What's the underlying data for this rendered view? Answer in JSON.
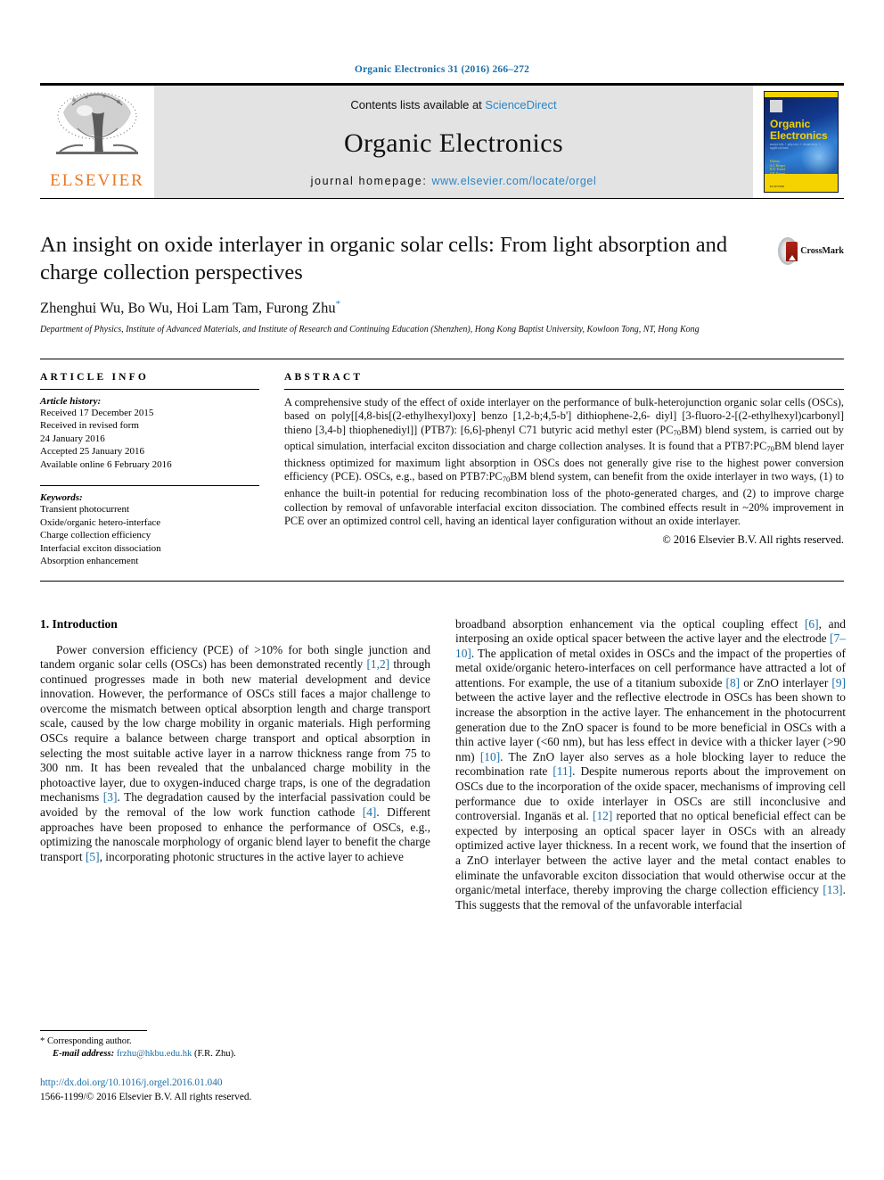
{
  "running_head": "Organic Electronics 31 (2016) 266–272",
  "masthead": {
    "contents_prefix": "Contents lists available at ",
    "contents_link": "ScienceDirect",
    "journal_title": "Organic Electronics",
    "homepage_prefix": "journal homepage: ",
    "homepage_link": "www.elsevier.com/locate/orgel",
    "publisher_name": "ELSEVIER",
    "cover": {
      "line1": "Organic",
      "line2": "Electronics",
      "tagline": "materials • physics • chemistry • applications",
      "editors": "Editors:\nA.J. Heeger\nR.H. Friend\nS.R. Forrest\nY. Yang",
      "publisher": "ELSEVIER"
    }
  },
  "article": {
    "title": "An insight on oxide interlayer in organic solar cells: From light absorption and charge collection perspectives",
    "crossmark_label": "CrossMark",
    "authors": "Zhenghui Wu, Bo Wu, Hoi Lam Tam, Furong Zhu",
    "corresponding_marker": "*",
    "affiliation": "Department of Physics, Institute of Advanced Materials, and Institute of Research and Continuing Education (Shenzhen), Hong Kong Baptist University, Kowloon Tong, NT, Hong Kong"
  },
  "article_info": {
    "heading": "ARTICLE INFO",
    "history_label": "Article history:",
    "history": [
      "Received 17 December 2015",
      "Received in revised form",
      "24 January 2016",
      "Accepted 25 January 2016",
      "Available online 6 February 2016"
    ],
    "keywords_label": "Keywords:",
    "keywords": [
      "Transient photocurrent",
      "Oxide/organic hetero-interface",
      "Charge collection efficiency",
      "Interfacial exciton dissociation",
      "Absorption enhancement"
    ]
  },
  "abstract": {
    "heading": "ABSTRACT",
    "part1": "A comprehensive study of the effect of oxide interlayer on the performance of bulk-heterojunction organic solar cells (OSCs), based on poly[[4,8-bis[(2-ethylhexyl)oxy] benzo [1,2-b;4,5-b'] dithiophene-2,6- diyl] [3-fluoro-2-[(2-ethylhexyl)carbonyl] thieno [3,4-b] thiophenediyl]] (PTB7): [6,6]-phenyl C71 butyric acid methyl ester (PC",
    "sub1": "70",
    "part2": "BM) blend system, is carried out by optical simulation, interfacial exciton dissociation and charge collection analyses. It is found that a PTB7:PC",
    "sub2": "70",
    "part3": "BM blend layer thickness optimized for maximum light absorption in OSCs does not generally give rise to the highest power conversion efficiency (PCE). OSCs, e.g., based on PTB7:PC",
    "sub3": "70",
    "part4": "BM blend system, can benefit from the oxide interlayer in two ways, (1) to enhance the built-in potential for reducing recombination loss of the photo-generated charges, and (2) to improve charge collection by removal of unfavorable interfacial exciton dissociation. The combined effects result in ~20% improvement in PCE over an optimized control cell, having an identical layer configuration without an oxide interlayer.",
    "copyright": "© 2016 Elsevier B.V. All rights reserved."
  },
  "body": {
    "section_heading": "1. Introduction",
    "left_p1_a": "Power conversion efficiency (PCE) of >10% for both single junction and tandem organic solar cells (OSCs) has been demonstrated recently ",
    "left_ref_1_2": "[1,2]",
    "left_p1_b": " through continued progresses made in both new material development and device innovation. However, the performance of OSCs still faces a major challenge to overcome the mismatch between optical absorption length and charge transport scale, caused by the low charge mobility in organic materials. High performing OSCs require a balance between charge transport and optical absorption in selecting the most suitable active layer in a narrow thickness range from 75 to 300 nm. It has been revealed that the unbalanced charge mobility in the photoactive layer, due to oxygen-induced charge traps, is one of the degradation mechanisms ",
    "left_ref_3": "[3]",
    "left_p1_c": ". The degradation caused by the interfacial passivation could be avoided by the removal of the low work function cathode ",
    "left_ref_4": "[4]",
    "left_p1_d": ". Different approaches have been proposed to enhance the performance of OSCs, e.g., optimizing the nanoscale morphology of organic blend layer to benefit the charge transport ",
    "left_ref_5": "[5]",
    "left_p1_e": ", incorporating photonic structures in the active layer to achieve",
    "right_p_a": "broadband absorption enhancement via the optical coupling effect ",
    "right_ref_6": "[6]",
    "right_p_b": ", and interposing an oxide optical spacer between the active layer and the electrode ",
    "right_ref_7_10": "[7–10]",
    "right_p_c": ". The application of metal oxides in OSCs and the impact of the properties of metal oxide/organic hetero-interfaces on cell performance have attracted a lot of attentions. For example, the use of a titanium suboxide ",
    "right_ref_8": "[8]",
    "right_p_d": " or ZnO interlayer ",
    "right_ref_9": "[9]",
    "right_p_e": " between the active layer and the reflective electrode in OSCs has been shown to increase the absorption in the active layer. The enhancement in the photocurrent generation due to the ZnO spacer is found to be more beneficial in OSCs with a thin active layer (<60 nm), but has less effect in device with a thicker layer (>90 nm) ",
    "right_ref_10": "[10]",
    "right_p_f": ". The ZnO layer also serves as a hole blocking layer to reduce the recombination rate ",
    "right_ref_11": "[11]",
    "right_p_g": ". Despite numerous reports about the improvement on OSCs due to the incorporation of the oxide spacer, mechanisms of improving cell performance due to oxide interlayer in OSCs are still inconclusive and controversial. Inganäs et al. ",
    "right_ref_12": "[12]",
    "right_p_h": " reported that no optical beneficial effect can be expected by interposing an optical spacer layer in OSCs with an already optimized active layer thickness. In a recent work, we found that the insertion of a ZnO interlayer between the active layer and the metal contact enables to eliminate the unfavorable exciton dissociation that would otherwise occur at the organic/metal interface, thereby improving the charge collection efficiency ",
    "right_ref_13": "[13]",
    "right_p_i": ". This suggests that the removal of the unfavorable interfacial"
  },
  "footer": {
    "corresponding_marker": "*",
    "corresponding_text": "Corresponding author.",
    "email_label": "E-mail address:",
    "email": "frzhu@hkbu.edu.hk",
    "email_person": "(F.R. Zhu).",
    "doi": "http://dx.doi.org/10.1016/j.orgel.2016.01.040",
    "issn": "1566-1199/© 2016 Elsevier B.V. All rights reserved."
  },
  "colors": {
    "link": "#1a6fa8",
    "elsevier_orange": "#E87722",
    "banner_bg": "#e3e3e3"
  }
}
